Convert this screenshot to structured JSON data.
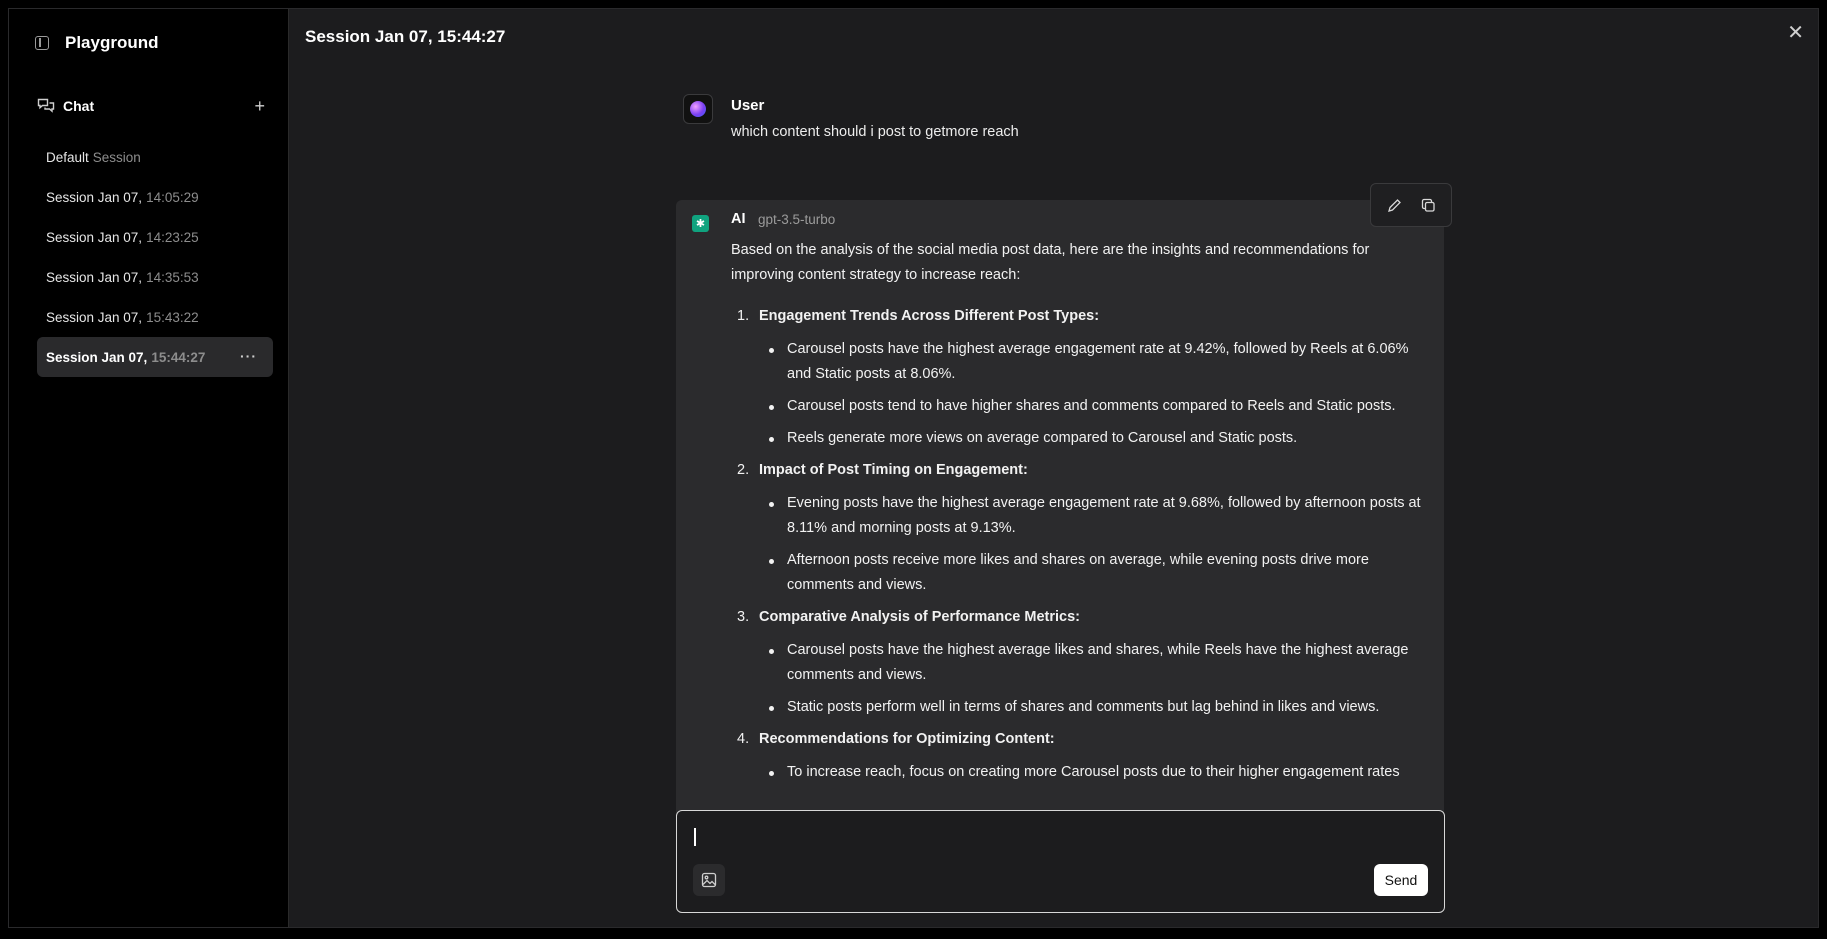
{
  "sidebar": {
    "title": "Playground",
    "chat_label": "Chat",
    "plus_label": "+",
    "sessions": [
      {
        "a": "Default",
        "b": "Session"
      },
      {
        "a": "Session Jan 07,",
        "b": "14:05:29"
      },
      {
        "a": "Session Jan 07,",
        "b": "14:23:25"
      },
      {
        "a": "Session Jan 07,",
        "b": "14:35:53"
      },
      {
        "a": "Session Jan 07,",
        "b": "15:43:22"
      },
      {
        "a": "Session Jan 07,",
        "b": "15:44:27"
      }
    ],
    "more_label": "···"
  },
  "main": {
    "title": "Session Jan 07, 15:44:27",
    "close_label": "✕"
  },
  "user_message": {
    "name": "User",
    "text": "which content should i post to getmore reach"
  },
  "ai_message": {
    "name": "AI",
    "model": "gpt-3.5-turbo",
    "intro": "Based on the analysis of the social media post data, here are the insights and recommendations for improving content strategy to increase reach:",
    "sections": [
      {
        "num": "1.",
        "heading": "Engagement Trends Across Different Post Types:",
        "bullets": [
          "Carousel posts have the highest average engagement rate at 9.42%, followed by Reels at 6.06% and Static posts at 8.06%.",
          "Carousel posts tend to have higher shares and comments compared to Reels and Static posts.",
          "Reels generate more views on average compared to Carousel and Static posts."
        ]
      },
      {
        "num": "2.",
        "heading": "Impact of Post Timing on Engagement:",
        "bullets": [
          "Evening posts have the highest average engagement rate at 9.68%, followed by afternoon posts at 8.11% and morning posts at 9.13%.",
          "Afternoon posts receive more likes and shares on average, while evening posts drive more comments and views."
        ]
      },
      {
        "num": "3.",
        "heading": "Comparative Analysis of Performance Metrics:",
        "bullets": [
          "Carousel posts have the highest average likes and shares, while Reels have the highest average comments and views.",
          "Static posts perform well in terms of shares and comments but lag behind in likes and views."
        ]
      },
      {
        "num": "4.",
        "heading": "Recommendations for Optimizing Content:",
        "bullets": [
          "To increase reach, focus on creating more Carousel posts due to their higher engagement rates"
        ]
      }
    ]
  },
  "composer": {
    "value": "",
    "send_label": "Send"
  },
  "colors": {
    "ai_logo": "#10a37f",
    "panel_bg": "#1c1c1e",
    "card_bg": "#2b2b2d"
  }
}
